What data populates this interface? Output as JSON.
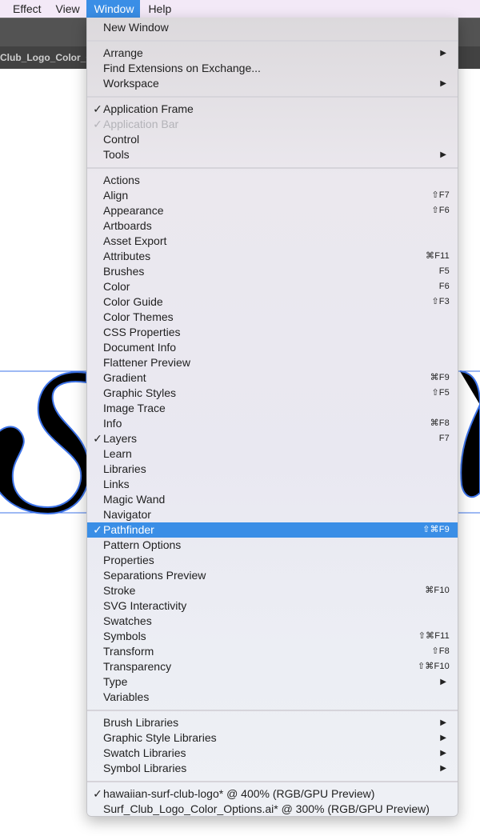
{
  "menubar": {
    "items": [
      {
        "label": "Effect",
        "active": false
      },
      {
        "label": "View",
        "active": false
      },
      {
        "label": "Window",
        "active": true
      },
      {
        "label": "Help",
        "active": false
      }
    ]
  },
  "document_tab": {
    "label": "Club_Logo_Color_Options"
  },
  "colors": {
    "accent": "#3a8ee6",
    "menubar_bg": "#f3e9f7",
    "toolbar_bg": "#535353",
    "tabstrip_bg": "#424242",
    "selection_path": "#3d73e8"
  },
  "menu": {
    "groups": [
      [
        {
          "label": "New Window"
        }
      ],
      [
        {
          "label": "Arrange",
          "submenu": true
        },
        {
          "label": "Find Extensions on Exchange..."
        },
        {
          "label": "Workspace",
          "submenu": true
        }
      ],
      [
        {
          "label": "Application Frame",
          "checked": true
        },
        {
          "label": "Application Bar",
          "checked": true,
          "disabled": true
        },
        {
          "label": "Control"
        },
        {
          "label": "Tools",
          "submenu": true
        }
      ],
      [
        {
          "label": "Actions"
        },
        {
          "label": "Align",
          "shortcut": "⇧F7"
        },
        {
          "label": "Appearance",
          "shortcut": "⇧F6"
        },
        {
          "label": "Artboards"
        },
        {
          "label": "Asset Export"
        },
        {
          "label": "Attributes",
          "shortcut": "⌘F11"
        },
        {
          "label": "Brushes",
          "shortcut": "F5"
        },
        {
          "label": "Color",
          "shortcut": "F6"
        },
        {
          "label": "Color Guide",
          "shortcut": "⇧F3"
        },
        {
          "label": "Color Themes"
        },
        {
          "label": "CSS Properties"
        },
        {
          "label": "Document Info"
        },
        {
          "label": "Flattener Preview"
        },
        {
          "label": "Gradient",
          "shortcut": "⌘F9"
        },
        {
          "label": "Graphic Styles",
          "shortcut": "⇧F5"
        },
        {
          "label": "Image Trace"
        },
        {
          "label": "Info",
          "shortcut": "⌘F8"
        },
        {
          "label": "Layers",
          "checked": true,
          "shortcut": "F7"
        },
        {
          "label": "Learn"
        },
        {
          "label": "Libraries"
        },
        {
          "label": "Links"
        },
        {
          "label": "Magic Wand"
        },
        {
          "label": "Navigator"
        },
        {
          "label": "Pathfinder",
          "checked": true,
          "selected": true,
          "shortcut": "⇧⌘F9"
        },
        {
          "label": "Pattern Options"
        },
        {
          "label": "Properties"
        },
        {
          "label": "Separations Preview"
        },
        {
          "label": "Stroke",
          "shortcut": "⌘F10"
        },
        {
          "label": "SVG Interactivity"
        },
        {
          "label": "Swatches"
        },
        {
          "label": "Symbols",
          "shortcut": "⇧⌘F11"
        },
        {
          "label": "Transform",
          "shortcut": "⇧F8"
        },
        {
          "label": "Transparency",
          "shortcut": "⇧⌘F10"
        },
        {
          "label": "Type",
          "submenu": true
        },
        {
          "label": "Variables"
        }
      ],
      [
        {
          "label": "Brush Libraries",
          "submenu": true
        },
        {
          "label": "Graphic Style Libraries",
          "submenu": true
        },
        {
          "label": "Swatch Libraries",
          "submenu": true
        },
        {
          "label": "Symbol Libraries",
          "submenu": true
        }
      ],
      [
        {
          "label": "hawaiian-surf-club-logo* @ 400% (RGB/GPU Preview)",
          "checked": true
        },
        {
          "label": "Surf_Club_Logo_Color_Options.ai* @ 300% (RGB/GPU Preview)"
        }
      ]
    ],
    "check_glyph": "✓",
    "submenu_glyph": "▶"
  }
}
